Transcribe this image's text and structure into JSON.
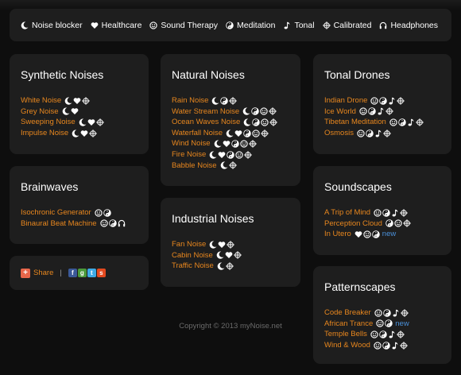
{
  "legend": [
    {
      "icon": "moon",
      "label": "Noise blocker"
    },
    {
      "icon": "heart",
      "label": "Healthcare"
    },
    {
      "icon": "smile",
      "label": "Sound Therapy"
    },
    {
      "icon": "yinyang",
      "label": "Meditation"
    },
    {
      "icon": "note",
      "label": "Tonal"
    },
    {
      "icon": "crosshair",
      "label": "Calibrated"
    },
    {
      "icon": "headphones",
      "label": "Headphones"
    }
  ],
  "cards": [
    {
      "id": "synthetic",
      "title": "Synthetic Noises",
      "items": [
        {
          "label": "White Noise",
          "icons": [
            "moon",
            "heart",
            "crosshair"
          ]
        },
        {
          "label": "Grey Noise",
          "icons": [
            "moon",
            "heart"
          ]
        },
        {
          "label": "Sweeping Noise",
          "icons": [
            "moon",
            "heart",
            "crosshair"
          ]
        },
        {
          "label": "Impulse Noise",
          "icons": [
            "moon",
            "heart",
            "crosshair"
          ]
        }
      ]
    },
    {
      "id": "brainwaves",
      "title": "Brainwaves",
      "items": [
        {
          "label": "Isochronic Generator",
          "icons": [
            "smile",
            "yinyang"
          ]
        },
        {
          "label": "Binaural Beat Machine",
          "icons": [
            "smile",
            "yinyang",
            "headphones"
          ]
        }
      ]
    },
    {
      "id": "natural",
      "title": "Natural Noises",
      "items": [
        {
          "label": "Rain Noise",
          "icons": [
            "moon",
            "yinyang",
            "crosshair"
          ]
        },
        {
          "label": "Water Stream Noise",
          "icons": [
            "moon",
            "yinyang",
            "smile",
            "crosshair"
          ]
        },
        {
          "label": "Ocean Waves Noise",
          "icons": [
            "moon",
            "yinyang",
            "smile",
            "crosshair"
          ]
        },
        {
          "label": "Waterfall Noise",
          "icons": [
            "moon",
            "heart",
            "yinyang",
            "smile",
            "crosshair"
          ]
        },
        {
          "label": "Wind Noise",
          "icons": [
            "moon",
            "heart",
            "yinyang",
            "smile",
            "crosshair"
          ]
        },
        {
          "label": "Fire Noise",
          "icons": [
            "moon",
            "heart",
            "yinyang",
            "smile",
            "crosshair"
          ]
        },
        {
          "label": "Babble Noise",
          "icons": [
            "moon",
            "crosshair"
          ]
        }
      ]
    },
    {
      "id": "industrial",
      "title": "Industrial Noises",
      "items": [
        {
          "label": "Fan Noise",
          "icons": [
            "moon",
            "heart",
            "crosshair"
          ]
        },
        {
          "label": "Cabin Noise",
          "icons": [
            "moon",
            "heart",
            "crosshair"
          ]
        },
        {
          "label": "Traffic Noise",
          "icons": [
            "moon",
            "crosshair"
          ]
        }
      ]
    },
    {
      "id": "tonal",
      "title": "Tonal Drones",
      "items": [
        {
          "label": "Indian Drone",
          "icons": [
            "smile",
            "yinyang",
            "note",
            "crosshair"
          ]
        },
        {
          "label": "Ice World",
          "icons": [
            "smile",
            "yinyang",
            "note",
            "crosshair"
          ]
        },
        {
          "label": "Tibetan Meditation",
          "icons": [
            "smile",
            "yinyang",
            "note",
            "crosshair"
          ]
        },
        {
          "label": "Osmosis",
          "icons": [
            "smile",
            "yinyang",
            "note",
            "crosshair"
          ]
        }
      ]
    },
    {
      "id": "soundscapes",
      "title": "Soundscapes",
      "items": [
        {
          "label": "A Trip of Mind",
          "icons": [
            "smile",
            "yinyang",
            "note",
            "crosshair"
          ]
        },
        {
          "label": "Perception Cloud",
          "icons": [
            "yinyang",
            "smile",
            "crosshair"
          ]
        },
        {
          "label": "In Utero",
          "icons": [
            "heart",
            "smile",
            "yinyang"
          ],
          "badge": "new"
        }
      ]
    },
    {
      "id": "patternscapes",
      "title": "Patternscapes",
      "items": [
        {
          "label": "Code Breaker",
          "icons": [
            "smile",
            "yinyang",
            "note",
            "crosshair"
          ]
        },
        {
          "label": "African Trance",
          "icons": [
            "smile",
            "yinyang"
          ],
          "badge": "new"
        },
        {
          "label": "Temple Bells",
          "icons": [
            "smile",
            "yinyang",
            "note",
            "crosshair"
          ]
        },
        {
          "label": "Wind & Wood",
          "icons": [
            "smile",
            "yinyang",
            "note",
            "crosshair"
          ]
        }
      ]
    }
  ],
  "share": {
    "label": "Share",
    "separator": "|",
    "services": [
      {
        "icon": "facebook-icon",
        "color": "#3b5998"
      },
      {
        "icon": "google-icon",
        "color": "#4b9a3a"
      },
      {
        "icon": "twitter-icon",
        "color": "#3ea9e4"
      },
      {
        "icon": "stumbleupon-icon",
        "color": "#e4491f"
      }
    ]
  },
  "copyright": "Copyright © 2013 myNoise.net",
  "colors": {
    "background": "#0e0e0e",
    "card": "#1e1e1e",
    "link": "#e8871e",
    "new_badge": "#4a90d9"
  }
}
